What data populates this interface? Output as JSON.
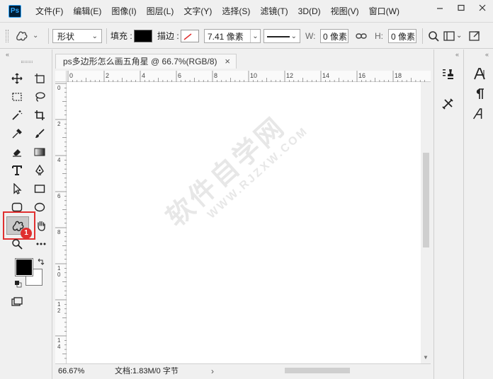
{
  "app": {
    "logo": "Ps"
  },
  "menu": {
    "items": [
      {
        "label": "文件(F)"
      },
      {
        "label": "编辑(E)"
      },
      {
        "label": "图像(I)"
      },
      {
        "label": "图层(L)"
      },
      {
        "label": "文字(Y)"
      },
      {
        "label": "选择(S)"
      },
      {
        "label": "滤镜(T)"
      },
      {
        "label": "3D(D)"
      },
      {
        "label": "视图(V)"
      },
      {
        "label": "窗口(W)"
      }
    ]
  },
  "options": {
    "mode_value": "形状",
    "fill_label": "填充 :",
    "stroke_label": "描边 :",
    "stroke_width": "7.41 像素",
    "w_label": "W:",
    "w_value": "0 像素",
    "h_label": "H:",
    "h_value": "0 像素"
  },
  "document": {
    "tab_title": "ps多边形怎么画五角星 @ 66.7%(RGB/8)",
    "close_glyph": "×",
    "ruler_h_ticks": [
      "0",
      "2",
      "4",
      "6",
      "8",
      "10",
      "12",
      "14",
      "16",
      "18"
    ],
    "ruler_v_ticks": [
      "0",
      "2",
      "4",
      "6",
      "8",
      "1\n0",
      "1\n2",
      "1\n4"
    ],
    "status_zoom": "66.67%",
    "status_doc": "文档:1.83M/0 字节"
  },
  "toolbar": {
    "badge": "1"
  },
  "watermark": {
    "main": "软件自学网",
    "sub": "WWW.RJZXW.COM"
  },
  "colors": {
    "foreground": "#000000",
    "background": "#ffffff",
    "highlight": "#e03030"
  }
}
